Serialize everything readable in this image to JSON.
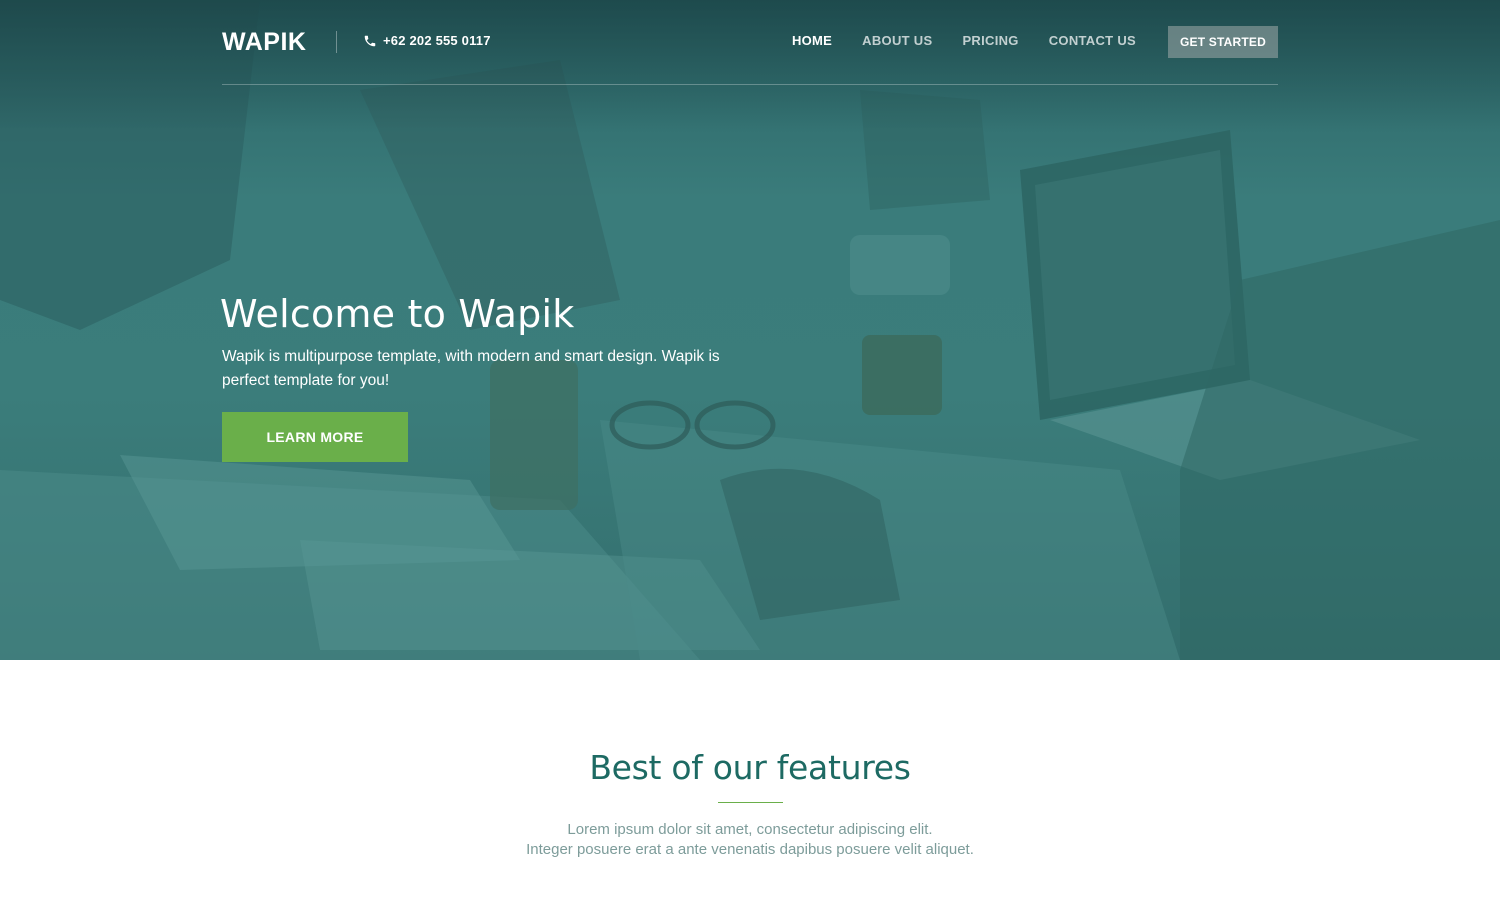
{
  "navbar": {
    "logo": "WAPIK",
    "phone": "+62 202 555 0117",
    "links": [
      {
        "label": "HOME",
        "active": true
      },
      {
        "label": "ABOUT US",
        "active": false
      },
      {
        "label": "PRICING",
        "active": false
      },
      {
        "label": "CONTACT US",
        "active": false
      }
    ],
    "cta_label": "GET STARTED"
  },
  "hero": {
    "title": "Welcome to Wapik",
    "text": "Wapik is multipurpose template, with modern and smart design. Wapik is perfect template for you!",
    "button_label": "LEARN MORE"
  },
  "features": {
    "title": "Best of our features",
    "line1": "Lorem ipsum dolor sit amet, consectetur adipiscing elit.",
    "line2": "Integer posuere erat a ante venenatis dapibus posuere velit aliquet."
  },
  "colors": {
    "accent_green": "#6aaf4a",
    "teal_overlay": "#3a7c7b",
    "heading_teal": "#1d6a63"
  }
}
